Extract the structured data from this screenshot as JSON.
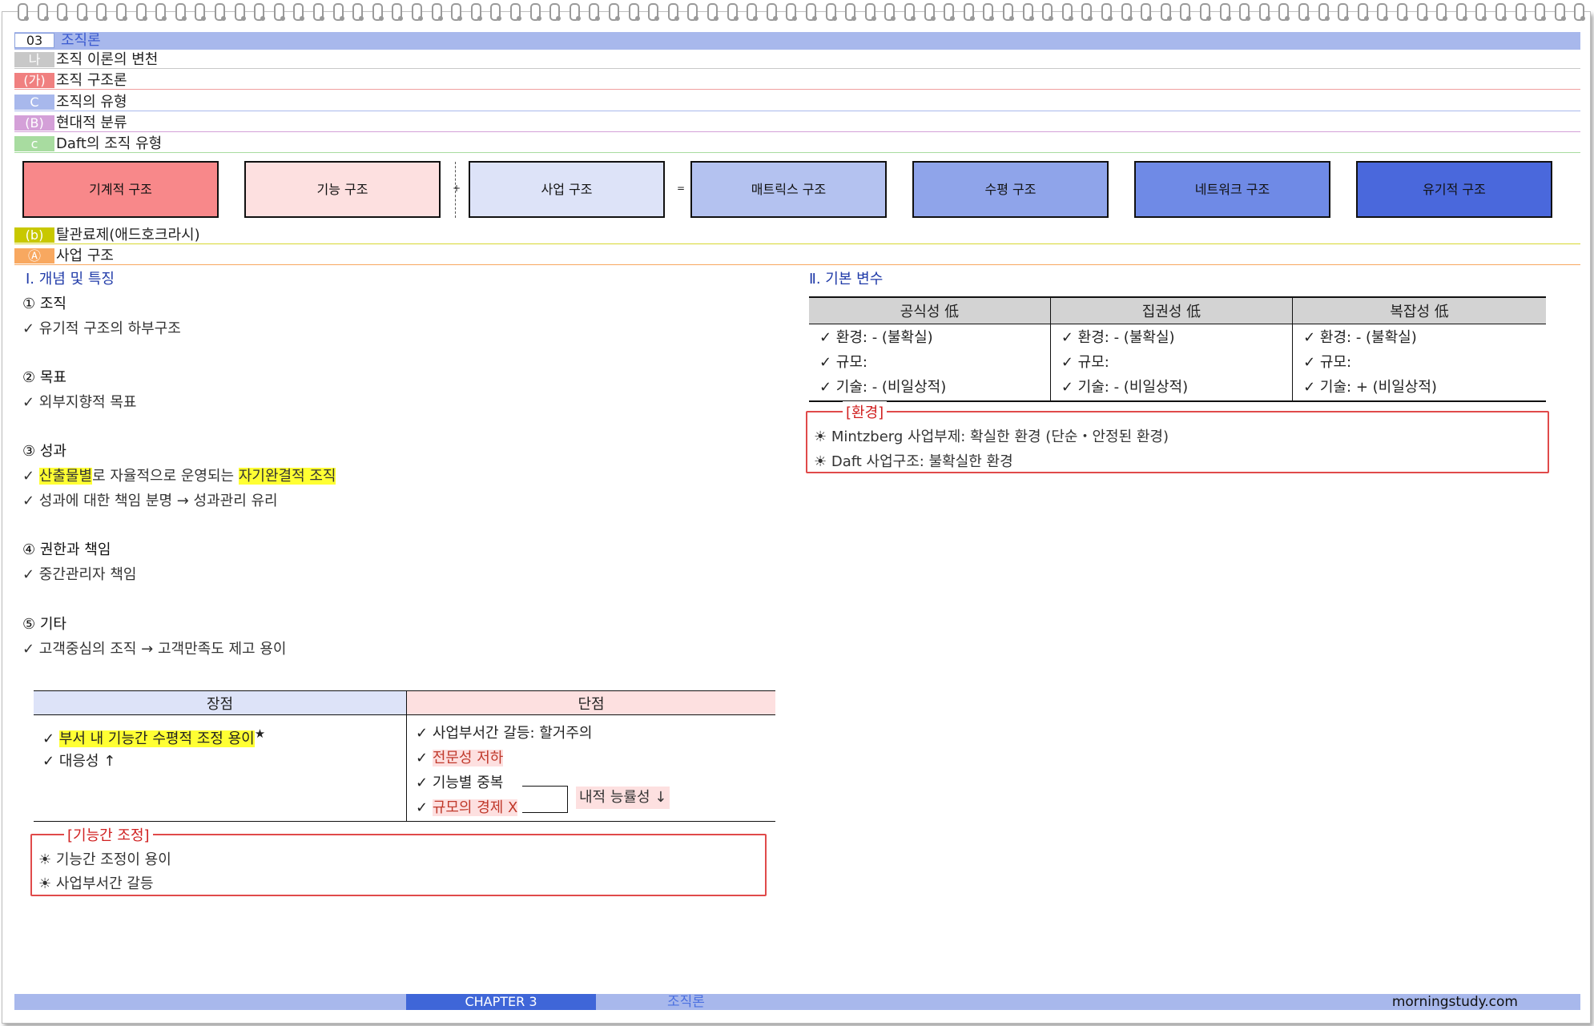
{
  "header": {
    "num": "03",
    "title": "조직론",
    "rows": [
      {
        "badge": "나",
        "text": "조직 이론의 변천",
        "badge_color": "#c8c8c8",
        "line_color": "#c8c8c8"
      },
      {
        "badge": "(가)",
        "text": "조직 구조론",
        "badge_color": "#f08080",
        "line_color": "#f0a0a0"
      },
      {
        "badge": "C",
        "text": "조직의 유형",
        "badge_color": "#a8b8ec",
        "line_color": "#a8b8ec"
      },
      {
        "badge": "(B)",
        "text": "현대적 분류",
        "badge_color": "#d4a0d8",
        "line_color": "#d4a0d8"
      },
      {
        "badge": "c",
        "text": "Daft의 조직 유형",
        "badge_color": "#a8dca0",
        "line_color": "#a8dca0"
      }
    ]
  },
  "structures": [
    {
      "label": "기계적 구조",
      "color": "#f8888a"
    },
    {
      "label": "기능 구조",
      "color": "#fde0e0"
    },
    {
      "label": "사업 구조",
      "color": "#dde3f8"
    },
    {
      "label": "매트릭스 구조",
      "color": "#b4c2f0"
    },
    {
      "label": "수평 구조",
      "color": "#8fa4ea"
    },
    {
      "label": "네트워크 구조",
      "color": "#6f8ae6"
    },
    {
      "label": "유기적 구조",
      "color": "#4a68dc"
    }
  ],
  "ops": {
    "plus": "+",
    "eq": "="
  },
  "sub_rows": [
    {
      "badge": "(b)",
      "text": "탈관료제(애드호크라시)",
      "badge_color": "#c8c800",
      "line_color": "#d8d830"
    },
    {
      "badge": "Ⓐ",
      "text": "사업 구조",
      "badge_color": "#f8a860",
      "line_color": "#f8a860"
    }
  ],
  "left": {
    "section_title": "Ⅰ. 개념 및 특징",
    "h1": "① 조직",
    "h1_items": [
      "✓ 유기적 구조의 하부구조"
    ],
    "h2": "② 목표",
    "h2_items": [
      "✓ 외부지향적 목표"
    ],
    "h3": "③ 성과",
    "h3_item1": {
      "check": "✓ ",
      "hl1": "산출물별",
      "mid": "로 자율적으로 운영되는 ",
      "hl2": "자기완결적 조직"
    },
    "h3_item2": "✓ 성과에 대한 책임 분명 → 성과관리 유리",
    "h4": "④ 권한과 책임",
    "h4_items": [
      "✓ 중간관리자 책임"
    ],
    "h5": "⑤ 기타",
    "h5_items": [
      "✓ 고객중심의 조직 → 고객만족도 제고 용이"
    ]
  },
  "pros_cons": {
    "pros_head": "장점",
    "cons_head": "단점",
    "pros": [
      {
        "check": "✓ ",
        "text": "부서 내 기능간 수평적 조정 용이",
        "star": "★"
      },
      {
        "check": "✓ ",
        "text": "대응성 ↑"
      }
    ],
    "cons": [
      {
        "check": "✓ ",
        "text": "사업부서간 갈등: 할거주의"
      },
      {
        "check": "✓ ",
        "text": "전문성 저하"
      },
      {
        "check": "✓ ",
        "text": "기능별 중복"
      },
      {
        "check": "✓ ",
        "text": "규모의 경제 X"
      }
    ],
    "bracket_label": "내적 능률성 ↓"
  },
  "coord_box": {
    "label": "[기능간 조정]",
    "items": [
      "☀ 기능간 조정이 용이",
      "☀ 사업부서간 갈등"
    ]
  },
  "right": {
    "section_title": "Ⅱ. 기본 변수",
    "columns": [
      {
        "head": "공식성 低",
        "items": [
          "✓ 환경: - (불확실)",
          "✓ 규모:",
          "✓ 기술: - (비일상적)"
        ]
      },
      {
        "head": "집권성 低",
        "items": [
          "✓ 환경: - (불확실)",
          "✓ 규모:",
          "✓ 기술: - (비일상적)"
        ]
      },
      {
        "head": "복잡성 低",
        "items": [
          "✓ 환경: - (불확실)",
          "✓ 규모:",
          "✓ 기술: + (비일상적)"
        ]
      }
    ],
    "env_box": {
      "label": "[환경]",
      "items": [
        "☀ Mintzberg 사업부제: 확실한 환경 (단순・안정된 환경)",
        "☀ Daft 사업구조: 불확실한 환경"
      ]
    }
  },
  "footer": {
    "chapter": "CHAPTER 3",
    "name": "조직론",
    "site": "morningstudy.com"
  }
}
